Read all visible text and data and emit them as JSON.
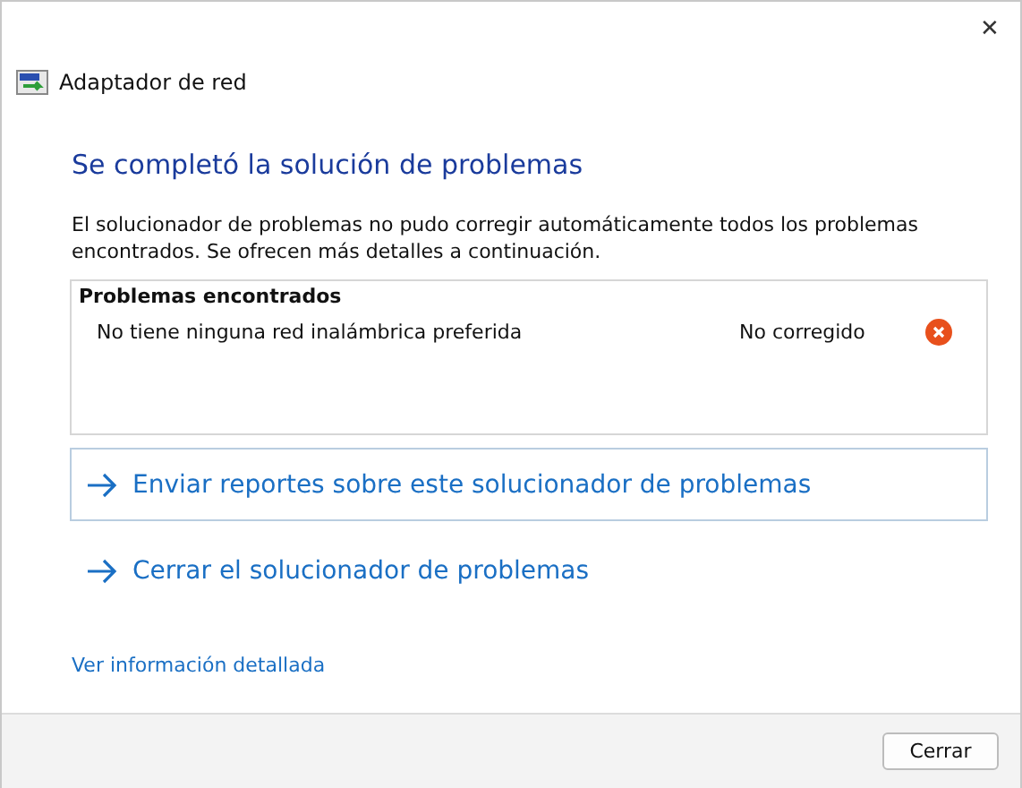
{
  "window": {
    "title": "Adaptador de red",
    "close": "✕"
  },
  "heading": "Se completó la solución de problemas",
  "description": "El solucionador de problemas no pudo corregir automáticamente todos los problemas encontrados. Se ofrecen más detalles a continuación.",
  "problems": {
    "title": "Problemas encontrados",
    "rows": [
      {
        "name": "No tiene ninguna red inalámbrica preferida",
        "status": "No corregido",
        "fixed": false
      }
    ]
  },
  "actions": [
    {
      "label": "Enviar reportes sobre este solucionador de problemas",
      "focused": true
    },
    {
      "label": "Cerrar el solucionador de problemas",
      "focused": false
    }
  ],
  "details_link": "Ver información detallada",
  "buttons": [
    "Cerrar"
  ]
}
